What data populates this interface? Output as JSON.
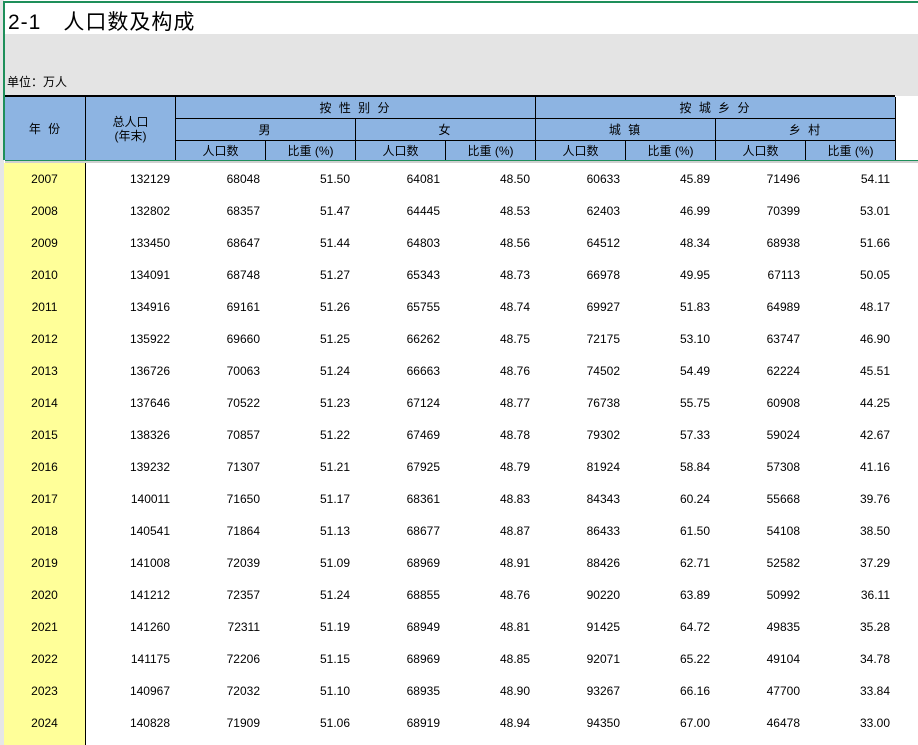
{
  "title": "2-1　人口数及构成",
  "unit": "单位：万人",
  "headers": {
    "year": "年 份",
    "total": "总人口\n(年末)",
    "by_sex": "按 性 别 分",
    "male": "男",
    "female": "女",
    "by_area": "按 城 乡 分",
    "urban": "城 镇",
    "rural": "乡 村",
    "pop": "人口数",
    "share": "比重 (%)"
  },
  "rows": [
    [
      "2007",
      "132129",
      "68048",
      "51.50",
      "64081",
      "48.50",
      "60633",
      "45.89",
      "71496",
      "54.11"
    ],
    [
      "2008",
      "132802",
      "68357",
      "51.47",
      "64445",
      "48.53",
      "62403",
      "46.99",
      "70399",
      "53.01"
    ],
    [
      "2009",
      "133450",
      "68647",
      "51.44",
      "64803",
      "48.56",
      "64512",
      "48.34",
      "68938",
      "51.66"
    ],
    [
      "2010",
      "134091",
      "68748",
      "51.27",
      "65343",
      "48.73",
      "66978",
      "49.95",
      "67113",
      "50.05"
    ],
    [
      "2011",
      "134916",
      "69161",
      "51.26",
      "65755",
      "48.74",
      "69927",
      "51.83",
      "64989",
      "48.17"
    ],
    [
      "2012",
      "135922",
      "69660",
      "51.25",
      "66262",
      "48.75",
      "72175",
      "53.10",
      "63747",
      "46.90"
    ],
    [
      "2013",
      "136726",
      "70063",
      "51.24",
      "66663",
      "48.76",
      "74502",
      "54.49",
      "62224",
      "45.51"
    ],
    [
      "2014",
      "137646",
      "70522",
      "51.23",
      "67124",
      "48.77",
      "76738",
      "55.75",
      "60908",
      "44.25"
    ],
    [
      "2015",
      "138326",
      "70857",
      "51.22",
      "67469",
      "48.78",
      "79302",
      "57.33",
      "59024",
      "42.67"
    ],
    [
      "2016",
      "139232",
      "71307",
      "51.21",
      "67925",
      "48.79",
      "81924",
      "58.84",
      "57308",
      "41.16"
    ],
    [
      "2017",
      "140011",
      "71650",
      "51.17",
      "68361",
      "48.83",
      "84343",
      "60.24",
      "55668",
      "39.76"
    ],
    [
      "2018",
      "140541",
      "71864",
      "51.13",
      "68677",
      "48.87",
      "86433",
      "61.50",
      "54108",
      "38.50"
    ],
    [
      "2019",
      "141008",
      "72039",
      "51.09",
      "68969",
      "48.91",
      "88426",
      "62.71",
      "52582",
      "37.29"
    ],
    [
      "2020",
      "141212",
      "72357",
      "51.24",
      "68855",
      "48.76",
      "90220",
      "63.89",
      "50992",
      "36.11"
    ],
    [
      "2021",
      "141260",
      "72311",
      "51.19",
      "68949",
      "48.81",
      "91425",
      "64.72",
      "49835",
      "35.28"
    ],
    [
      "2022",
      "141175",
      "72206",
      "51.15",
      "68969",
      "48.85",
      "92071",
      "65.22",
      "49104",
      "34.78"
    ],
    [
      "2023",
      "140967",
      "72032",
      "51.10",
      "68935",
      "48.90",
      "93267",
      "66.16",
      "47700",
      "33.84"
    ],
    [
      "2024",
      "140828",
      "71909",
      "51.06",
      "68919",
      "48.94",
      "94350",
      "67.00",
      "46478",
      "33.00"
    ]
  ]
}
